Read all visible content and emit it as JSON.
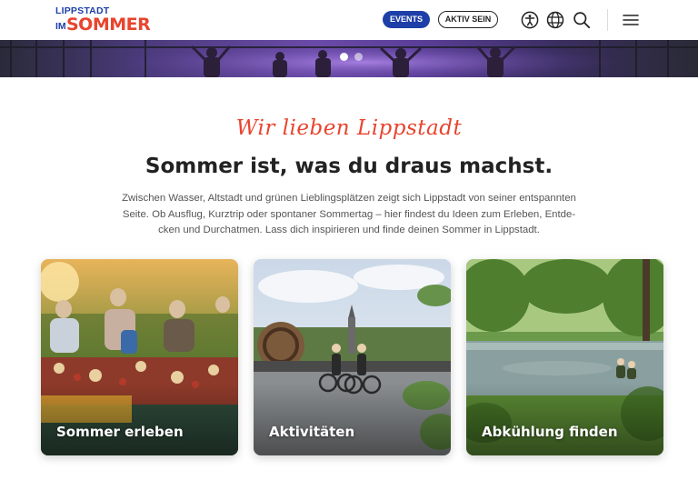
{
  "header": {
    "logo": {
      "line1": "LIPPSTADT",
      "im": "IM",
      "sommer": "SOMMER"
    },
    "events_label": "EVENTS",
    "aktiv_label": "AKTIV SEIN",
    "icons": [
      "accessibility-icon",
      "globe-icon",
      "search-icon",
      "menu-icon"
    ]
  },
  "hero": {
    "slides_total": 2,
    "active_slide": 1
  },
  "intro": {
    "script_title": "Wir lieben Lippstadt",
    "headline": "Sommer ist, was du draus machst.",
    "lead_lines": [
      "Zwischen Wasser, Altstadt und grünen Lieblingsplätzen zeigt sich Lippstadt von seiner entspannten",
      "Seite. Ob Ausflug, Kurztrip oder spontaner Sommertag – hier findest du Ideen zum Erleben, Entde-",
      "cken und Durchatmen. Lass dich inspirieren und finde deinen Sommer in Lippstadt."
    ]
  },
  "cards": [
    {
      "label": "Sommer erleben"
    },
    {
      "label": "Aktivitäten"
    },
    {
      "label": "Abkühlung finden"
    }
  ],
  "colors": {
    "brand_blue": "#1e3fa8",
    "brand_red": "#e8442e"
  }
}
